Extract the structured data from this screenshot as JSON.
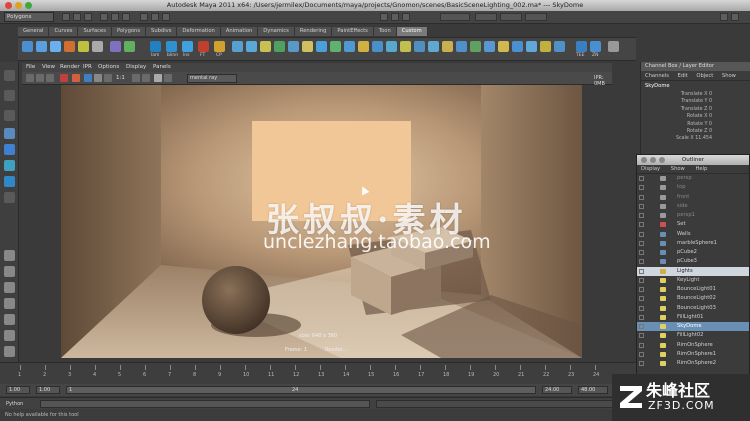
{
  "window": {
    "title": "Autodesk Maya 2011 x64: /Users/jermilex/Documents/maya/projects/Gnomon/scenes/BasicSceneLighting_002.ma*   ---   SkyDome"
  },
  "status_line": {
    "menu_set": "Polygons"
  },
  "shelf": {
    "tabs": [
      "General",
      "Curves",
      "Surfaces",
      "Polygons",
      "Subdivs",
      "Deformation",
      "Animation",
      "Dynamics",
      "Rendering",
      "PaintEffects",
      "Toon",
      "Custom"
    ],
    "active_tab": "Custom",
    "icon_labels": [
      "lam",
      "blinn",
      "lns",
      "FT",
      "CP",
      "TEE",
      "ZN"
    ]
  },
  "panel": {
    "menus": [
      "File",
      "View",
      "Render",
      "IPR",
      "Options",
      "Display",
      "Panels"
    ],
    "ratio": "1:1",
    "render_mode": "mental ray",
    "ipr_memory": "IPR: 0MB"
  },
  "render_view": {
    "watermark_cn": "张叔叔·素材",
    "watermark_url": "unclezhang.taobao.com",
    "info_size": "size: 640 x 360",
    "info_frame": "Frame: 1",
    "info_render": "Render..."
  },
  "channel_box": {
    "title": "Channel Box / Layer Editor",
    "menus": [
      "Channels",
      "Edit",
      "Object",
      "Show"
    ],
    "object": "SkyDome",
    "attributes": [
      "Translate X 0",
      "Translate Y 0",
      "Translate Z 0",
      "Rotate X 0",
      "Rotate Y 0",
      "Rotate Z 0",
      "Scale X 11.454"
    ]
  },
  "outliner": {
    "title": "Outliner",
    "menus": [
      "Display",
      "Show",
      "Help"
    ],
    "items": [
      {
        "label": "persp",
        "style": "dim",
        "icon": "camera-icon",
        "color": "#9a9a9a"
      },
      {
        "label": "top",
        "style": "dim",
        "icon": "camera-icon",
        "color": "#9a9a9a"
      },
      {
        "label": "front",
        "style": "dim",
        "icon": "camera-icon",
        "color": "#9a9a9a"
      },
      {
        "label": "side",
        "style": "dim",
        "icon": "camera-icon",
        "color": "#9a9a9a"
      },
      {
        "label": "persp1",
        "style": "dim",
        "icon": "camera-icon",
        "color": "#9a9a9a"
      },
      {
        "label": "Set",
        "style": "",
        "icon": "set-icon",
        "color": "#d05050"
      },
      {
        "label": "Walls",
        "style": "",
        "icon": "mesh-icon",
        "color": "#6a8fb5"
      },
      {
        "label": "marbleSphere1",
        "style": "",
        "icon": "mesh-icon",
        "color": "#6a8fb5"
      },
      {
        "label": "pCube2",
        "style": "",
        "icon": "mesh-icon",
        "color": "#6a8fb5"
      },
      {
        "label": "pCube3",
        "style": "",
        "icon": "mesh-icon",
        "color": "#6a8fb5"
      },
      {
        "label": "Lights",
        "style": "hl2",
        "icon": "group-icon",
        "color": "#d0b040"
      },
      {
        "label": "KeyLight",
        "style": "",
        "icon": "light-icon",
        "color": "#e0d060"
      },
      {
        "label": "BounceLight01",
        "style": "",
        "icon": "light-icon",
        "color": "#e0d060"
      },
      {
        "label": "BounceLight02",
        "style": "",
        "icon": "light-icon",
        "color": "#e0d060"
      },
      {
        "label": "BounceLight03",
        "style": "",
        "icon": "light-icon",
        "color": "#e0d060"
      },
      {
        "label": "FillLight01",
        "style": "",
        "icon": "light-icon",
        "color": "#e0d060"
      },
      {
        "label": "SkyDome",
        "style": "hl",
        "icon": "light-icon",
        "color": "#e0d060"
      },
      {
        "label": "FillLight02",
        "style": "",
        "icon": "light-icon",
        "color": "#e0d060"
      },
      {
        "label": "RimOnSphere",
        "style": "",
        "icon": "light-icon",
        "color": "#e0d060"
      },
      {
        "label": "RimOnSphere1",
        "style": "",
        "icon": "light-icon",
        "color": "#e0d060"
      },
      {
        "label": "RimOnSphere2",
        "style": "",
        "icon": "light-icon",
        "color": "#e0d060"
      }
    ]
  },
  "timeline": {
    "ticks": [
      "1",
      "2",
      "3",
      "4",
      "5",
      "6",
      "7",
      "8",
      "9",
      "10",
      "11",
      "12",
      "13",
      "14",
      "15",
      "16",
      "17",
      "18",
      "19",
      "20",
      "21",
      "22",
      "23",
      "24"
    ]
  },
  "range_slider": {
    "start_a": "1.00",
    "start_b": "1.00",
    "marker": "1",
    "end_marker": "24",
    "end_a": "24.00",
    "end_b": "48.00"
  },
  "command_line": {
    "lang": "Python"
  },
  "help_line": {
    "text": "No help available for this tool"
  },
  "corner_logo": {
    "text_cn": "朱峰社区",
    "text_en": "ZF3D.COM"
  }
}
